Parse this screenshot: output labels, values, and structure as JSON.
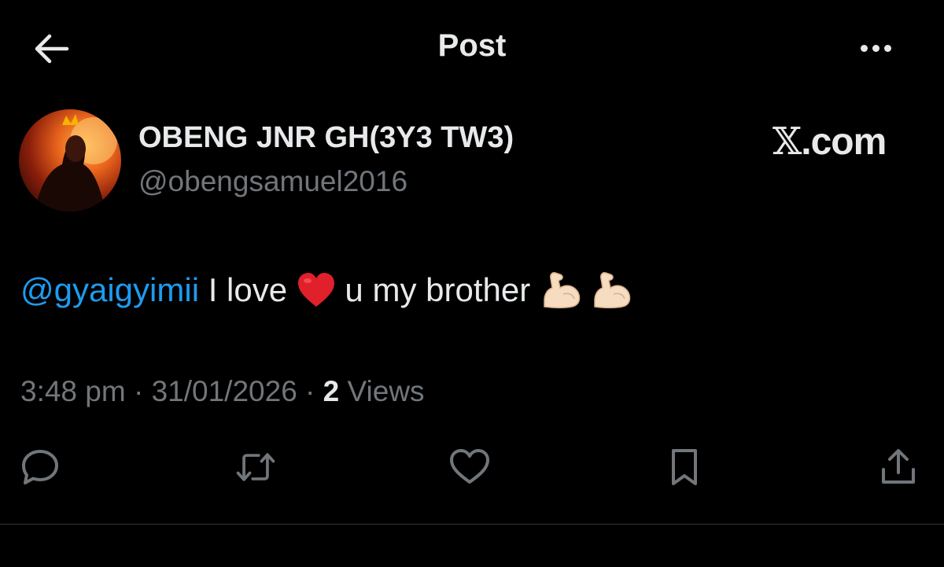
{
  "header": {
    "title": "Post",
    "back_icon": "arrow-left-icon",
    "more_icon": "more-horizontal-icon"
  },
  "author": {
    "name": "OBENG JNR GH(3Y3 TW3)",
    "handle": "@obengsamuel2016"
  },
  "brand": {
    "mark": "𝕏",
    "text": ".com"
  },
  "tweet": {
    "mention": "@gyaigyimii",
    "text_before_heart": " I love ",
    "text_after_heart": " u my brother ",
    "emojis": [
      "red-heart",
      "flexed-biceps",
      "flexed-biceps"
    ]
  },
  "meta": {
    "time": "3:48 pm",
    "sep1": " · ",
    "date": "31/01/2026",
    "sep2": " · ",
    "views_count": "2",
    "views_label": " Views"
  },
  "actions": [
    "reply-icon",
    "repost-icon",
    "like-icon",
    "bookmark-icon",
    "share-icon"
  ],
  "colors": {
    "background": "#000000",
    "text": "#e7e9ea",
    "secondary": "#71767b",
    "link": "#1d9bf0",
    "heart": "#e0202a",
    "divider": "#2f3336"
  }
}
